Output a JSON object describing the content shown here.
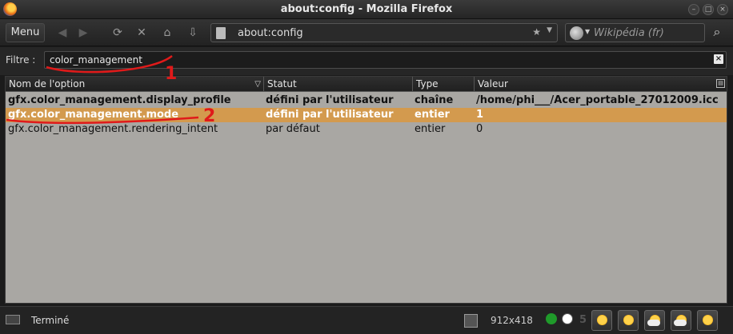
{
  "window": {
    "title": "about:config - Mozilla Firefox"
  },
  "toolbar": {
    "menu_label": "Menu",
    "url": "about:config",
    "search_placeholder": "Wikipédia (fr)"
  },
  "filter": {
    "label": "Filtre :",
    "value": "color_management"
  },
  "table": {
    "columns": [
      "Nom de l'option",
      "Statut",
      "Type",
      "Valeur"
    ],
    "rows": [
      {
        "name": "gfx.color_management.display_profile",
        "status": "défini par l'utilisateur",
        "type": "chaîne",
        "value": "/home/phi___/Acer_portable_27012009.icc",
        "bold": true,
        "selected": false
      },
      {
        "name": "gfx.color_management.mode",
        "status": "défini par l'utilisateur",
        "type": "entier",
        "value": "1",
        "bold": true,
        "selected": true
      },
      {
        "name": "gfx.color_management.rendering_intent",
        "status": "par défaut",
        "type": "entier",
        "value": "0",
        "bold": false,
        "selected": false
      }
    ]
  },
  "statusbar": {
    "text": "Terminé",
    "resolution": "912x418",
    "counter": "5"
  },
  "annotations": {
    "first": "1",
    "second": "2"
  },
  "colors": {
    "selection": "#d39a4e",
    "annotation": "#e01a1a",
    "table_bg": "#a9a7a3"
  }
}
